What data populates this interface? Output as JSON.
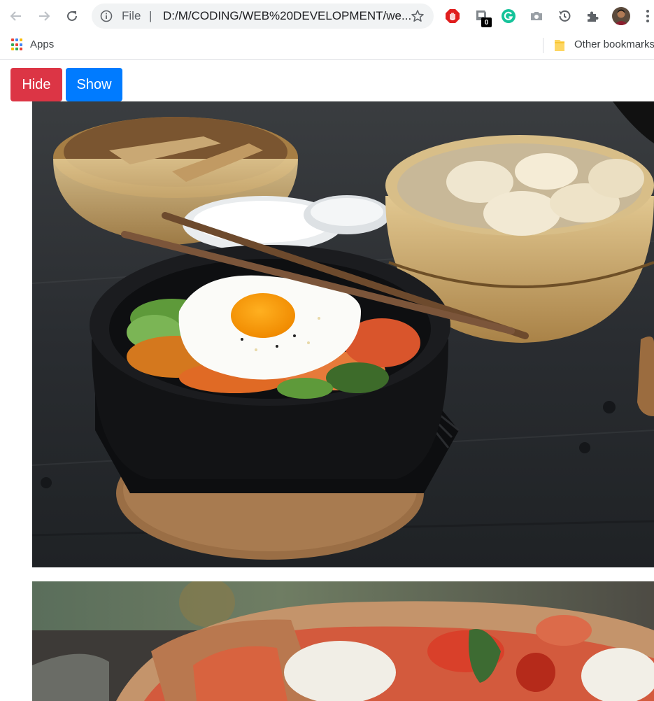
{
  "browser": {
    "omnibox": {
      "scheme_label": "File",
      "separator": "|",
      "url": "D:/M/CODING/WEB%20DEVELOPMENT/we..."
    },
    "extensions": [
      {
        "name": "adblock-icon",
        "color": "#e01e1e"
      },
      {
        "name": "extension-badge-icon",
        "badge": "0"
      },
      {
        "name": "grammarly-icon",
        "color": "#15c39a"
      },
      {
        "name": "camera-icon"
      },
      {
        "name": "history-icon"
      },
      {
        "name": "puzzle-extensions-icon"
      },
      {
        "name": "profile-avatar"
      },
      {
        "name": "menu-kebab-icon"
      }
    ]
  },
  "bookmarks": {
    "apps_label": "Apps",
    "other_label": "Other bookmarks"
  },
  "page": {
    "hide_label": "Hide",
    "show_label": "Show",
    "hide_color": "#dc3545",
    "show_color": "#007bff",
    "images": [
      {
        "subject": "bibimbap stone bowl with fried egg and chopsticks, dumplings in bamboo steamer"
      },
      {
        "subject": "pizza with tomato and basil (partially visible)"
      }
    ]
  }
}
